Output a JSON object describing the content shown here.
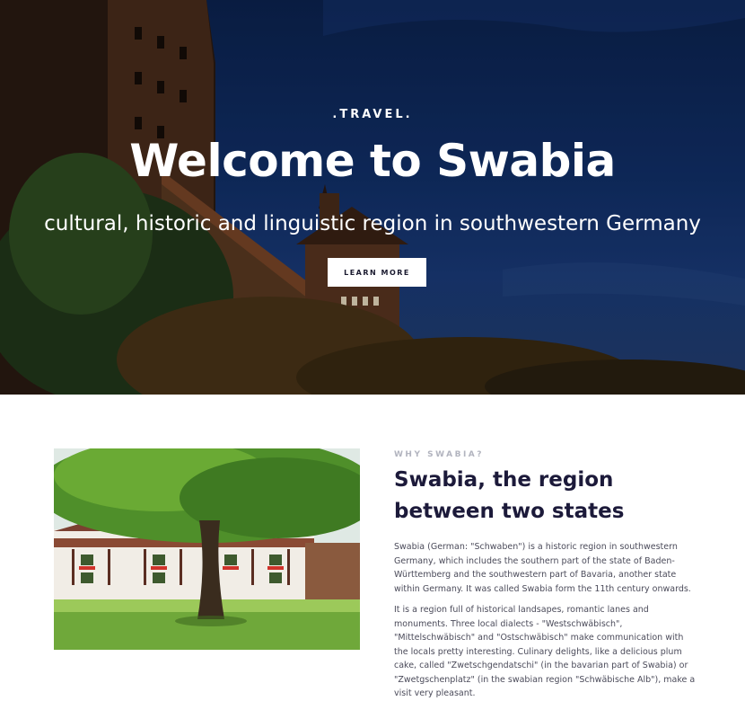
{
  "hero": {
    "kicker": ".TRAVEL.",
    "title": "Welcome to Swabia",
    "subtitle": "cultural, historic and linguistic region in southwestern Germany",
    "button_label": "LEARN MORE"
  },
  "intro": {
    "eyebrow": "WHY SWABIA?",
    "title_line1": "Swabia, the region",
    "title_line2": "between two states",
    "paragraphs": [
      "Swabia (German: \"Schwaben\") is a historic region in southwestern Germany, which includes the southern part of the state of Baden-Württemberg and the southwestern part of Bavaria, another state within Germany. It was called Swabia form the 11th century onwards.",
      "It is a region full of historical landsapes, romantic lanes and monuments. Three local dialects - \"Westschwäbisch\", \"Mittelschwäbisch\" and \"Ostschwäbisch\" make communication with the locals pretty interesting. Culinary delights, like a delicious plum cake, called \"Zwetschgendatschi\" (in the bavarian part of Swabia) or \"Zwetgschenplatz\" (in the swabian region \"Schwäbische Alb\"), make a visit very pleasant."
    ]
  },
  "colors": {
    "sky": "#11306a",
    "heading": "#1c1a3a",
    "eyebrow": "#b2b4bf",
    "body_text": "#4b4b5a"
  }
}
